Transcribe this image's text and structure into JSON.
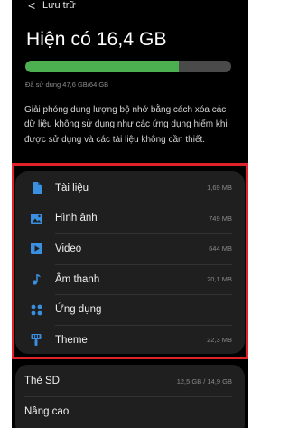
{
  "header": {
    "back_glyph": "<",
    "title": "Lưu trữ"
  },
  "storage": {
    "available_label": "Hiện có 16,4 GB",
    "used_label": "Đã sử dụng 47,6 GB/64 GB",
    "used_fraction": 0.744,
    "description": "Giải phóng dung lượng bộ nhớ bằng cách xóa các dữ liệu không sử dụng như các ứng dụng hiếm khi được sử dụng và các tài liệu không cần thiết."
  },
  "categories": [
    {
      "label": "Tài liệu",
      "size": "1,69 MB",
      "icon": "document-icon"
    },
    {
      "label": "Hình ảnh",
      "size": "749 MB",
      "icon": "image-icon"
    },
    {
      "label": "Video",
      "size": "644 MB",
      "icon": "video-icon"
    },
    {
      "label": "Âm thanh",
      "size": "20,1 MB",
      "icon": "music-note-icon"
    },
    {
      "label": "Ứng dụng",
      "size": "",
      "icon": "apps-icon"
    },
    {
      "label": "Theme",
      "size": "22,3 MB",
      "icon": "paint-brush-icon"
    }
  ],
  "sd_card": {
    "label": "Thẻ SD",
    "size": "12,5 GB / 14,9 GB"
  },
  "advanced": {
    "label": "Nâng cao"
  },
  "colors": {
    "accent": "#3a8fe0",
    "bar_fill": "#4caf50",
    "highlight": "#e0232a"
  }
}
